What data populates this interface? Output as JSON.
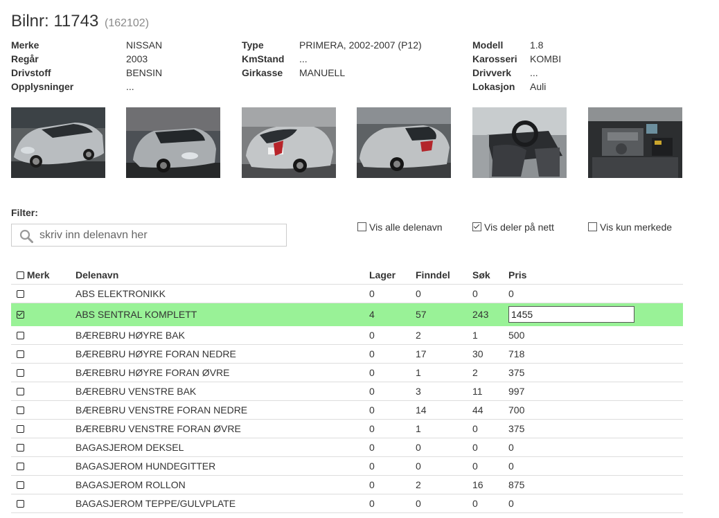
{
  "header": {
    "title": "Bilnr: 11743",
    "sub": "(162102)"
  },
  "info": {
    "col1": [
      {
        "label": "Merke",
        "value": "NISSAN"
      },
      {
        "label": "Regår",
        "value": "2003"
      },
      {
        "label": "Drivstoff",
        "value": "BENSIN"
      },
      {
        "label": "Opplysninger",
        "value": "..."
      }
    ],
    "col2": [
      {
        "label": "Type",
        "value": "PRIMERA, 2002-2007 (P12)"
      },
      {
        "label": "KmStand",
        "value": "..."
      },
      {
        "label": "Girkasse",
        "value": "MANUELL"
      }
    ],
    "col3": [
      {
        "label": "Modell",
        "value": "1.8"
      },
      {
        "label": "Karosseri",
        "value": "KOMBI"
      },
      {
        "label": "Drivverk",
        "value": "..."
      },
      {
        "label": "Lokasjon",
        "value": "Auli"
      }
    ]
  },
  "photos": [
    "car-front-left-photo",
    "car-front-photo",
    "car-rear-photo",
    "car-rear-right-photo",
    "car-interior-photo",
    "engine-bay-photo"
  ],
  "filter": {
    "label": "Filter:",
    "placeholder": "skriv inn delenavn her",
    "options": [
      {
        "label": "Vis alle delenavn",
        "checked": false
      },
      {
        "label": "Vis deler på nett",
        "checked": true
      },
      {
        "label": "Vis kun merkede",
        "checked": false
      }
    ]
  },
  "table": {
    "headers": {
      "merk": "Merk",
      "name": "Delenavn",
      "lager": "Lager",
      "finndel": "Finndel",
      "sok": "Søk",
      "pris": "Pris"
    },
    "highlight_color": "#99f297",
    "rows": [
      {
        "name": "ABS ELEKTRONIKK",
        "lager": "0",
        "finndel": "0",
        "sok": "0",
        "pris": "0",
        "checked": false
      },
      {
        "name": "ABS SENTRAL KOMPLETT",
        "lager": "4",
        "finndel": "57",
        "sok": "243",
        "pris": "1455",
        "checked": true
      },
      {
        "name": "BÆREBRU HØYRE BAK",
        "lager": "0",
        "finndel": "2",
        "sok": "1",
        "pris": "500",
        "checked": false
      },
      {
        "name": "BÆREBRU HØYRE FORAN NEDRE",
        "lager": "0",
        "finndel": "17",
        "sok": "30",
        "pris": "718",
        "checked": false
      },
      {
        "name": "BÆREBRU HØYRE FORAN ØVRE",
        "lager": "0",
        "finndel": "1",
        "sok": "2",
        "pris": "375",
        "checked": false
      },
      {
        "name": "BÆREBRU VENSTRE BAK",
        "lager": "0",
        "finndel": "3",
        "sok": "11",
        "pris": "997",
        "checked": false
      },
      {
        "name": "BÆREBRU VENSTRE FORAN NEDRE",
        "lager": "0",
        "finndel": "14",
        "sok": "44",
        "pris": "700",
        "checked": false
      },
      {
        "name": "BÆREBRU VENSTRE FORAN ØVRE",
        "lager": "0",
        "finndel": "1",
        "sok": "0",
        "pris": "375",
        "checked": false
      },
      {
        "name": "BAGASJEROM DEKSEL",
        "lager": "0",
        "finndel": "0",
        "sok": "0",
        "pris": "0",
        "checked": false
      },
      {
        "name": "BAGASJEROM HUNDEGITTER",
        "lager": "0",
        "finndel": "0",
        "sok": "0",
        "pris": "0",
        "checked": false
      },
      {
        "name": "BAGASJEROM ROLLON",
        "lager": "0",
        "finndel": "2",
        "sok": "16",
        "pris": "875",
        "checked": false
      },
      {
        "name": "BAGASJEROM TEPPE/GULVPLATE",
        "lager": "0",
        "finndel": "0",
        "sok": "0",
        "pris": "0",
        "checked": false
      }
    ]
  }
}
